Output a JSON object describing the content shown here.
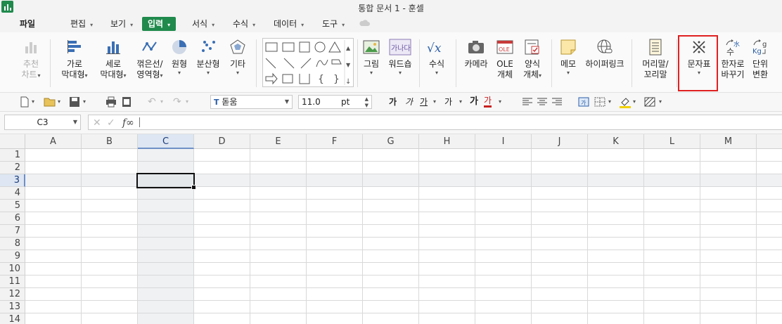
{
  "window": {
    "title": "통합 문서 1 - 훈셀"
  },
  "menubar": {
    "items": [
      {
        "label": "파일",
        "caret": ""
      },
      {
        "label": "편집",
        "caret": "▾"
      },
      {
        "label": "보기",
        "caret": "▾"
      },
      {
        "label": "입력",
        "caret": "▾"
      },
      {
        "label": "서식",
        "caret": "▾"
      },
      {
        "label": "수식",
        "caret": "▾"
      },
      {
        "label": "데이터",
        "caret": "▾"
      },
      {
        "label": "도구",
        "caret": "▾"
      }
    ],
    "active": "입력"
  },
  "ribbon": {
    "recommend_chart": {
      "line1": "추천",
      "line2": "차트"
    },
    "bar_chart": {
      "line1": "가로",
      "line2": "막대형"
    },
    "column_chart": {
      "line1": "세로",
      "line2": "막대형"
    },
    "line_chart": {
      "line1": "꺾은선/",
      "line2": "영역형"
    },
    "pie_chart": {
      "line1": "원형"
    },
    "scatter_chart": {
      "line1": "분산형"
    },
    "other_chart": {
      "line1": "기타"
    },
    "picture": {
      "line1": "그림"
    },
    "wordart": {
      "line1": "워드숍"
    },
    "formula": {
      "line1": "수식"
    },
    "camera": {
      "line1": "카메라"
    },
    "ole": {
      "line1": "OLE",
      "line2": "개체"
    },
    "form_object": {
      "line1": "양식",
      "line2": "개체"
    },
    "memo": {
      "line1": "메모"
    },
    "hyperlink": {
      "line1": "하이퍼링크"
    },
    "header_footer": {
      "line1": "머리말/",
      "line2": "꼬리말"
    },
    "symbol": {
      "line1": "문자표"
    },
    "hanja": {
      "line1": "한자로",
      "line2": "바꾸기"
    },
    "unit": {
      "line1": "단위",
      "line2": "변환"
    },
    "dropdown_glyph": "▾",
    "wordart_preview": "가나다",
    "ole_preview": "OLE",
    "hanja_preview": "수",
    "unit_preview": "Kg"
  },
  "toolbar": {
    "font_name": "돋움",
    "font_size": "11.0",
    "font_unit": "pt",
    "bold": "가",
    "italic": "가",
    "underline": "가",
    "strike": "가",
    "grow": "가",
    "color": "가"
  },
  "formula_bar": {
    "cell_ref": "C3",
    "fx": "f∞",
    "value": ""
  },
  "sheet": {
    "columns": [
      "A",
      "B",
      "C",
      "D",
      "E",
      "F",
      "G",
      "H",
      "I",
      "J",
      "K",
      "L",
      "M"
    ],
    "rows": [
      "1",
      "2",
      "3",
      "4",
      "5",
      "6",
      "7",
      "8",
      "9",
      "10",
      "11",
      "12",
      "13",
      "14"
    ],
    "selected_column": "C",
    "selected_row": "3"
  },
  "colors": {
    "accent": "#1f8a4c",
    "highlight": "#e02020",
    "selection": "#dde6f2"
  }
}
